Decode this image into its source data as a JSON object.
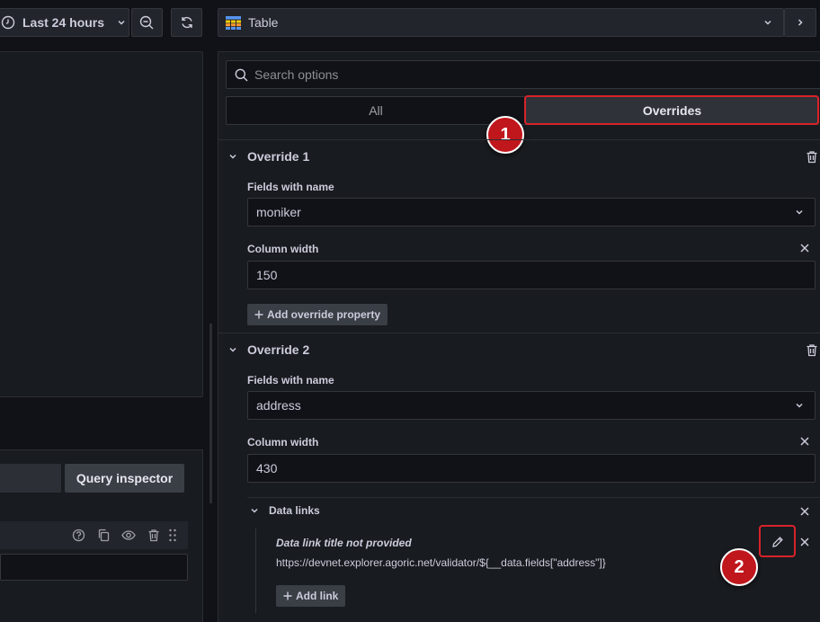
{
  "toolbar": {
    "time_range_label": "Last 24 hours",
    "visualization_label": "Table"
  },
  "left": {
    "query_inspector_label": "Query inspector"
  },
  "options": {
    "search_placeholder": "Search options",
    "tab_all": "All",
    "tab_overrides": "Overrides"
  },
  "overrides": [
    {
      "title": "Override 1",
      "matcher_label": "Fields with name",
      "matcher_value": "moniker",
      "property_label": "Column width",
      "property_value": "150",
      "add_property_label": "Add override property"
    },
    {
      "title": "Override 2",
      "matcher_label": "Fields with name",
      "matcher_value": "address",
      "property_label": "Column width",
      "property_value": "430",
      "data_links_label": "Data links",
      "data_link_title": "Data link title not provided",
      "data_link_url": "https://devnet.explorer.agoric.net/validator/${__data.fields[\"address\"]}",
      "add_link_label": "Add link"
    }
  ],
  "annotations": {
    "badge_1": "1",
    "badge_2": "2",
    "highlight_color": "#d8232a"
  }
}
